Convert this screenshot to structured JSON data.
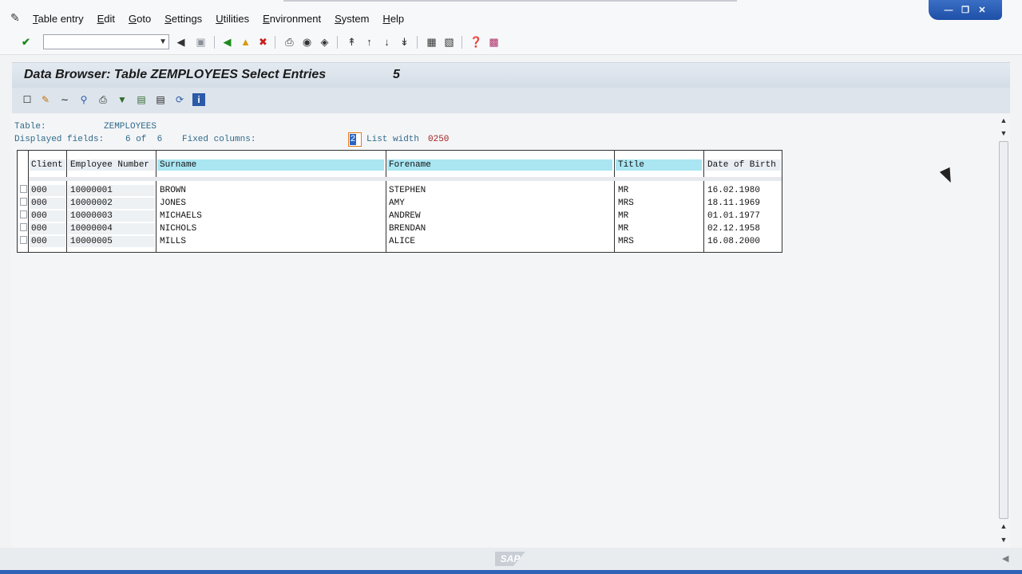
{
  "menubar": {
    "items": [
      "Table entry",
      "Edit",
      "Goto",
      "Settings",
      "Utilities",
      "Environment",
      "System",
      "Help"
    ]
  },
  "toolbar": {
    "command_field_value": ""
  },
  "title": {
    "text": "Data Browser: Table ZEMPLOYEES Select Entries",
    "count": "5"
  },
  "info": {
    "table_label": "Table:",
    "table_name": "ZEMPLOYEES",
    "displayed_label": "Displayed fields:",
    "displayed_value": "6 of  6",
    "fixed_label": "Fixed columns:",
    "fixed_value": "2",
    "listwidth_label": "List width",
    "listwidth_value": "0250"
  },
  "table": {
    "headers": [
      "Client",
      "Employee Number",
      "Surname",
      "Forename",
      "Title",
      "Date of Birth"
    ],
    "rows": [
      [
        "000",
        "10000001",
        "BROWN",
        "STEPHEN",
        "MR",
        "16.02.1980"
      ],
      [
        "000",
        "10000002",
        "JONES",
        "AMY",
        "MRS",
        "18.11.1969"
      ],
      [
        "000",
        "10000003",
        "MICHAELS",
        "ANDREW",
        "MR",
        "01.01.1977"
      ],
      [
        "000",
        "10000004",
        "NICHOLS",
        "BRENDAN",
        "MR",
        "02.12.1958"
      ],
      [
        "000",
        "10000005",
        "MILLS",
        "ALICE",
        "MRS",
        "16.08.2000"
      ]
    ]
  },
  "footer": {
    "logo_text": "SAP"
  },
  "colors": {
    "header_highlight": "#a9e6f2",
    "title_bg": "#d3dce6",
    "window_control": "#1e4fa6"
  }
}
